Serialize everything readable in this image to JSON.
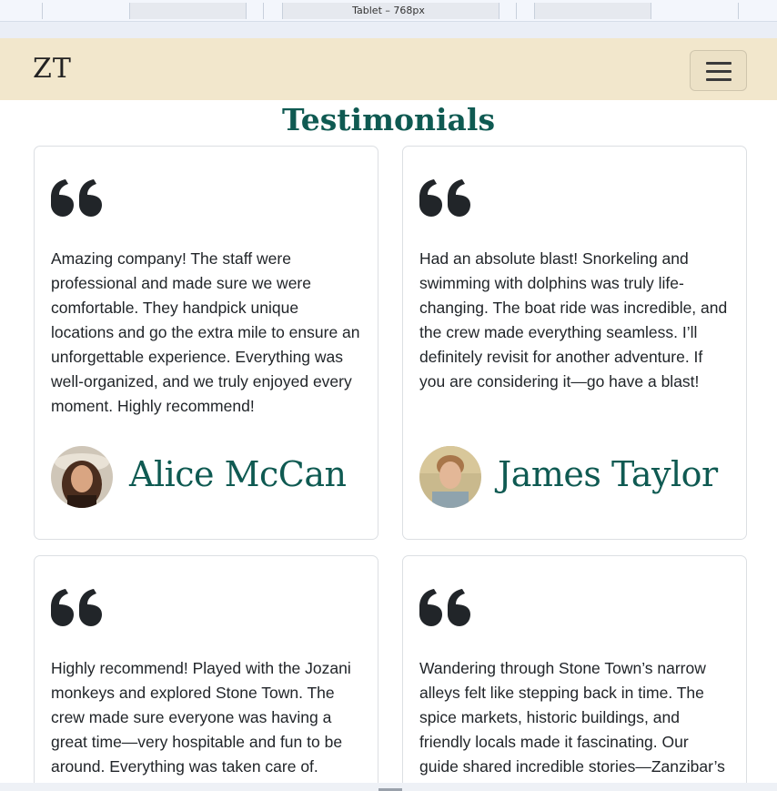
{
  "devtools": {
    "device_label": "Tablet – 768px"
  },
  "navbar": {
    "brand": "ZT",
    "toggle_icon": "hamburger-icon"
  },
  "testimonials": {
    "title": "Testimonials",
    "quote_icon": "quote-icon",
    "quote_color": "#212529",
    "accent_color": "#0f5a52",
    "navbar_color": "#f2e7cc",
    "cards": [
      {
        "lines": [
          "Amazing company! The staff were",
          "professional and made sure we were",
          "comfortable. They handpick unique",
          "locations and go the extra mile to ensure an",
          "unforgettable experience. Everything was",
          "well-organized, and we truly enjoyed every",
          "moment. Highly recommend!"
        ],
        "name": "Alice McCan",
        "avatar": "avatar-photo"
      },
      {
        "lines": [
          "Had an absolute blast! Snorkeling and",
          "swimming with dolphins was truly life-",
          "changing. The boat ride was incredible, and",
          "the crew made everything seamless. I’ll",
          "definitely revisit for another adventure. If",
          "you are considering it—go have a blast!"
        ],
        "name": "James Taylor",
        "avatar": "avatar-photo"
      },
      {
        "lines": [
          "Highly recommend! Played with the Jozani",
          "monkeys and explored Stone Town. The",
          "crew made sure everyone was having a",
          "great time—very hospitable and fun to be",
          "around. Everything was taken care of."
        ]
      },
      {
        "lines": [
          "Wandering through Stone Town’s narrow",
          "alleys felt like stepping back in time. The",
          "spice markets, historic buildings, and",
          "friendly locals made it fascinating. Our",
          "guide shared incredible stories—Zanzibar’s"
        ]
      }
    ]
  }
}
